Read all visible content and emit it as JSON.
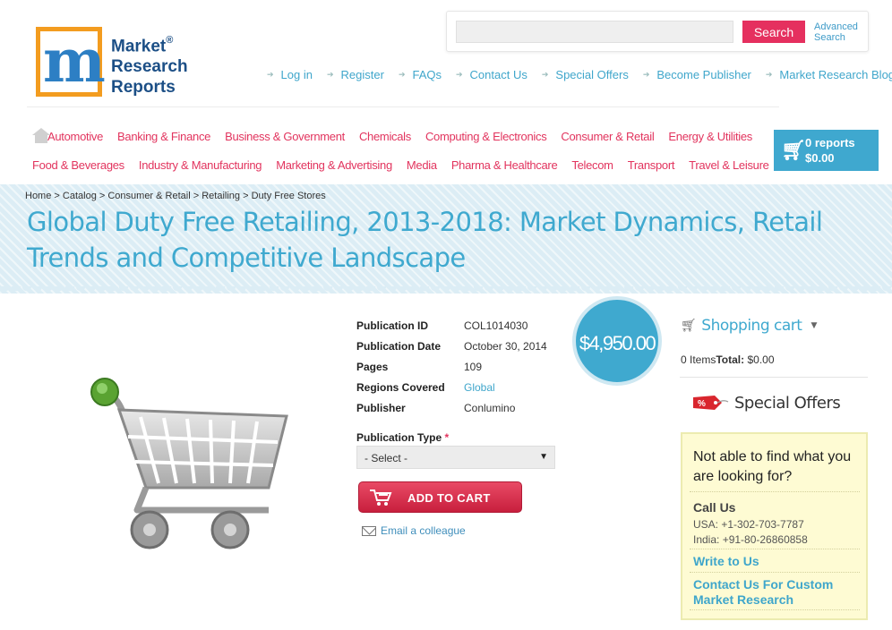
{
  "brand": {
    "logo_letter": "m",
    "name_line1": "Market",
    "name_line2": "Research",
    "name_line3": "Reports",
    "registered": "®"
  },
  "search": {
    "placeholder": "",
    "button_label": "Search",
    "advanced_line1": "Advanced",
    "advanced_line2": "Search"
  },
  "top_links": [
    "Log in",
    "Register",
    "FAQs",
    "Contact Us",
    "Special Offers",
    "Become Publisher",
    "Market Research Blog"
  ],
  "categories_row1": [
    "Automotive",
    "Banking & Finance",
    "Business & Government",
    "Chemicals",
    "Computing & Electronics",
    "Consumer & Retail",
    "Energy & Utilities"
  ],
  "categories_row2": [
    "Food & Beverages",
    "Industry & Manufacturing",
    "Marketing & Advertising",
    "Media",
    "Pharma & Healthcare",
    "Telecom",
    "Transport",
    "Travel & Leisure"
  ],
  "cart_summary": {
    "reports": "0 reports",
    "total": "$0.00"
  },
  "breadcrumb": [
    "Home",
    "Catalog",
    "Consumer & Retail",
    "Retailing",
    "Duty Free Stores"
  ],
  "page_title": "Global Duty Free Retailing, 2013-2018: Market Dynamics, Retail Trends and Competitive Landscape",
  "product": {
    "price": "$4,950.00",
    "details": [
      {
        "label": "Publication ID",
        "value": "COL1014030"
      },
      {
        "label": "Publication Date",
        "value": "October 30, 2014"
      },
      {
        "label": "Pages",
        "value": "109"
      },
      {
        "label": "Regions Covered",
        "value": "Global"
      },
      {
        "label": "Publisher",
        "value": "Conlumino"
      }
    ],
    "pub_type_label": "Publication Type",
    "pub_type_required": "*",
    "pub_type_selected": "- Select -",
    "add_to_cart": "ADD TO CART",
    "email_colleague": "Email a colleague"
  },
  "sidebar": {
    "cart_title": "Shopping cart",
    "cart_items": "0 Items",
    "cart_total_label": "Total:",
    "cart_total_value": "$0.00",
    "offers_title": "Special Offers",
    "offers_tag": "%",
    "help_question": "Not able to find what you are looking for?",
    "call_us": "Call Us",
    "phone_usa": "USA: +1-302-703-7787",
    "phone_india": "India: +91-80-26860858",
    "write_to_us": "Write to Us",
    "contact_custom": "Contact Us For Custom Market Research"
  },
  "colors": {
    "accent_blue": "#3fa9cf",
    "accent_pink": "#e2345e",
    "banner_bg": "#dcedf5",
    "help_box_bg": "#fefbd3"
  },
  "icons": [
    "home-icon",
    "cart-icon",
    "chevron-down-icon",
    "envelope-icon",
    "tag-icon",
    "shopping-cart-image"
  ]
}
